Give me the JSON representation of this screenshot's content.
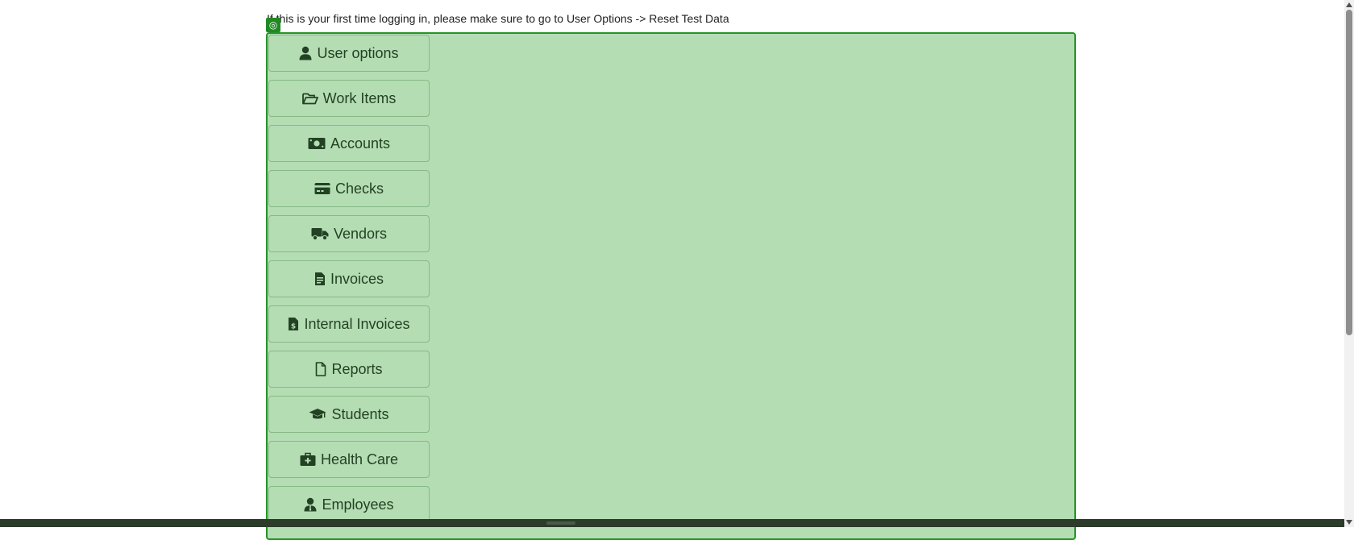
{
  "header": {
    "notice": "If this is your first time logging in, please make sure to go to User Options -> Reset Test Data"
  },
  "nav": {
    "items": [
      {
        "label": "User options",
        "icon": "user-icon"
      },
      {
        "label": "Work Items",
        "icon": "folder-open-icon"
      },
      {
        "label": "Accounts",
        "icon": "money-bill-icon"
      },
      {
        "label": "Checks",
        "icon": "credit-card-icon"
      },
      {
        "label": "Vendors",
        "icon": "truck-icon"
      },
      {
        "label": "Invoices",
        "icon": "file-invoice-icon"
      },
      {
        "label": "Internal Invoices",
        "icon": "file-invoice-dollar-icon"
      },
      {
        "label": "Reports",
        "icon": "file-icon"
      },
      {
        "label": "Students",
        "icon": "graduation-cap-icon"
      },
      {
        "label": "Health Care",
        "icon": "medical-kit-icon"
      },
      {
        "label": "Employees",
        "icon": "user-tie-icon"
      }
    ]
  },
  "colors": {
    "panel": "#b4ddb4",
    "panel_border": "#279227",
    "button_text": "#234223",
    "badge": "#1f8a22"
  }
}
